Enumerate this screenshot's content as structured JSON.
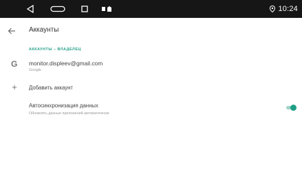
{
  "status_bar": {
    "time": "10:24",
    "icons": [
      "back-icon",
      "home-icon",
      "recents-icon",
      "sim-icon",
      "notification-icon",
      "location-icon"
    ]
  },
  "app_bar": {
    "title": "Аккаунты"
  },
  "section": {
    "header": "АККАУНТЫ – ВЛАДЕЛЕЦ"
  },
  "account": {
    "email": "monitor.displeev@gmail.com",
    "type": "Google"
  },
  "add_account": {
    "label": "Добавить аккаунт"
  },
  "sync": {
    "title": "Автосинхронизация данных",
    "subtitle": "Обновлять данные приложений автоматически",
    "enabled": true
  },
  "colors": {
    "accent": "#1f9e86",
    "statusbar": "#161616"
  }
}
